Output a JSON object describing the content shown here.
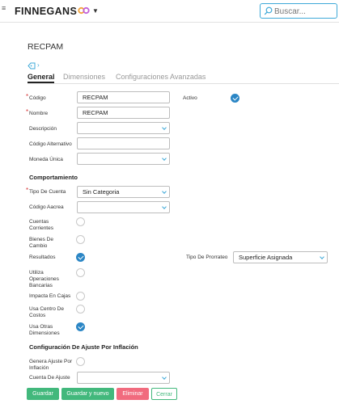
{
  "topbar": {
    "brand": "FINNEGANS",
    "search_placeholder": "Buscar..."
  },
  "page": {
    "title": "RECPAM",
    "tabs": [
      "General",
      "Dimensiones",
      "Configuraciones Avanzadas"
    ],
    "active_tab": "General"
  },
  "form": {
    "codigo": {
      "label": "Código",
      "value": "RECPAM",
      "required": true
    },
    "nombre": {
      "label": "Nombre",
      "value": "RECPAM",
      "required": true
    },
    "activo": {
      "label": "Activo",
      "checked": true
    },
    "descripcion": {
      "label": "Descripción",
      "value": ""
    },
    "codigo_alternativo": {
      "label": "Código Alternativo",
      "value": ""
    },
    "moneda_unica": {
      "label": "Moneda Única",
      "value": ""
    }
  },
  "comportamiento": {
    "title": "Comportamiento",
    "tipo_cuenta": {
      "label": "Tipo De Cuenta",
      "value": "Sin Categoria",
      "required": true
    },
    "codigo_aacrea": {
      "label": "Código Aacrea",
      "value": ""
    },
    "cuentas_corrientes": {
      "label": [
        "Cuentas",
        "Corrientes"
      ],
      "checked": false
    },
    "bienes_de_cambio": {
      "label": [
        "Bienes De",
        "Cambio"
      ],
      "checked": false
    },
    "resultados": {
      "label": "Resultados",
      "checked": true
    },
    "tipo_prorrateo": {
      "label": "Tipo De Prorrateo",
      "value": "Superficie Asignada"
    },
    "utiliza_operaciones_bancarias": {
      "label": [
        "Utiliza",
        "Operaciones",
        "Bancarias"
      ],
      "checked": false
    },
    "impacta_en_cajas": {
      "label": "Impacta En Cajas",
      "checked": false
    },
    "usa_centro_de_costos": {
      "label": [
        "Usa Centro De",
        "Costos"
      ],
      "checked": false
    },
    "usa_otras_dimensiones": {
      "label": [
        "Usa Otras",
        "Dimensiones"
      ],
      "checked": true
    }
  },
  "ajuste": {
    "title": "Configuración De Ajuste Por Inflación",
    "genera_ajuste": {
      "label": [
        "Genera Ajuste Por",
        "Inflación"
      ],
      "checked": false
    },
    "cuenta_de_ajuste": {
      "label": "Cuenta De Ajuste",
      "value": ""
    }
  },
  "buttons": {
    "guardar": "Guardar",
    "guardar_y_nuevo": "Guardar y nuevo",
    "eliminar": "Eliminar",
    "cerrar": "Cerrar"
  },
  "colors": {
    "accent": "#2b86c5",
    "search_border": "#3ea9d8",
    "button_green": "#42b87c",
    "button_red": "#f16b7e",
    "required": "#d9383a"
  }
}
